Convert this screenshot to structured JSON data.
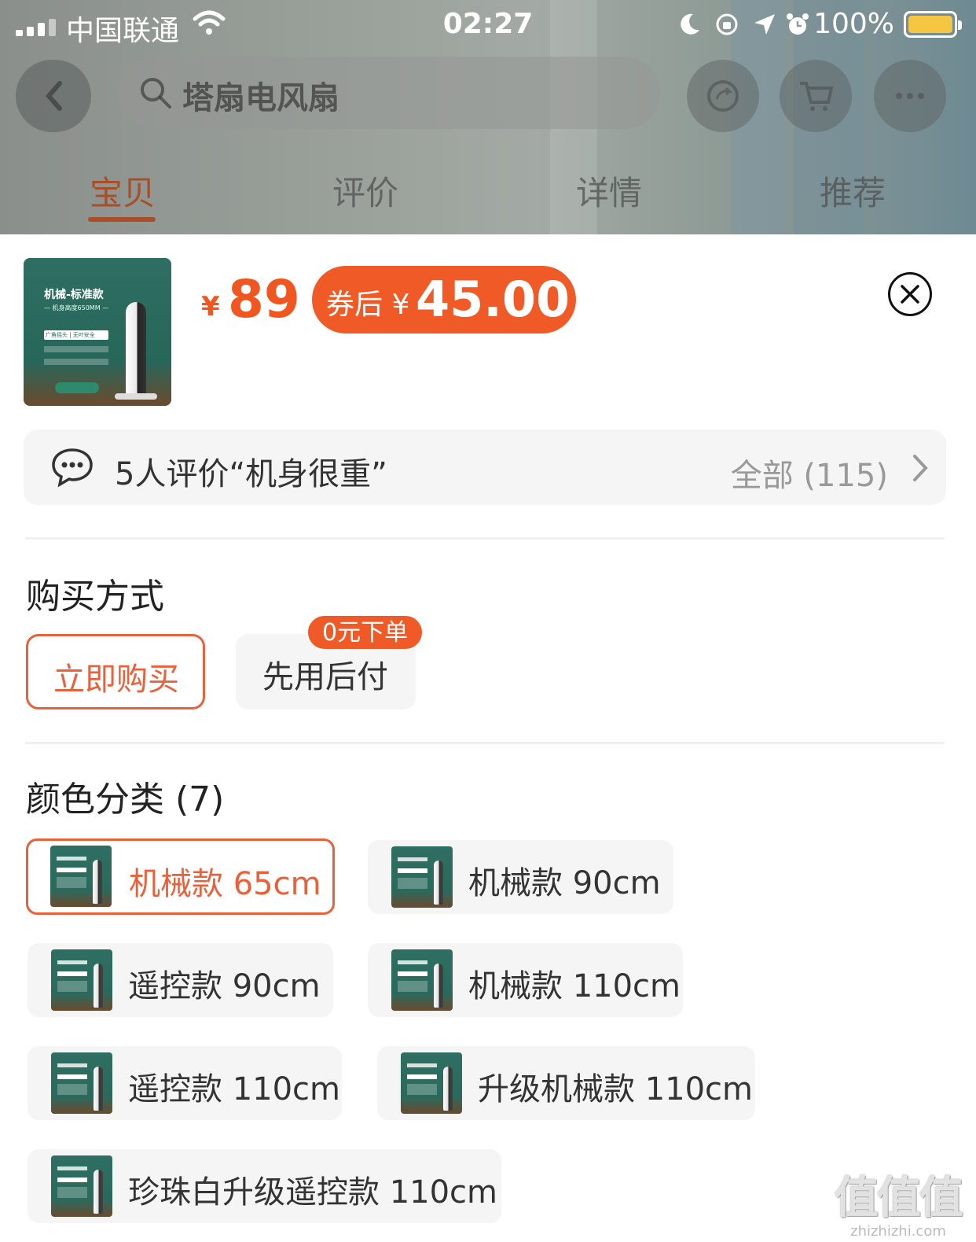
{
  "status_bar": {
    "carrier": "中国联通",
    "time": "02:27",
    "battery": "100%",
    "battery_color": "#f5c642"
  },
  "background_header": {
    "search_text": "塔扇电风扇",
    "tabs": [
      {
        "label": "宝贝",
        "active": true
      },
      {
        "label": "评价",
        "active": false
      },
      {
        "label": "详情",
        "active": false
      },
      {
        "label": "推荐",
        "active": false
      }
    ],
    "icons": [
      "back-icon",
      "search-icon",
      "share-icon",
      "cart-icon",
      "more-icon"
    ]
  },
  "sheet": {
    "product_image": {
      "title": "机械-标准款",
      "subtitle": "— 机身高度650MM —",
      "feature": "广角摇头 | 无叶安全"
    },
    "currency": "¥",
    "price": "89",
    "coupon_label": "券后 ¥",
    "coupon_price": "45.00",
    "accent_color": "#ef5a26",
    "review": {
      "text": "5人评价“机身很重”",
      "all": "全部 (115)"
    },
    "purchase": {
      "title": "购买方式",
      "options": [
        {
          "label": "立即购买",
          "selected": true
        },
        {
          "label": "先用后付",
          "selected": false
        }
      ],
      "badge": "0元下单"
    },
    "color": {
      "title": "颜色分类 (7)",
      "items": [
        {
          "label": "机械款 65cm",
          "selected": true
        },
        {
          "label": "机械款 90cm",
          "selected": false
        },
        {
          "label": "遥控款 90cm",
          "selected": false
        },
        {
          "label": "机械款 110cm",
          "selected": false
        },
        {
          "label": "遥控款 110cm",
          "selected": false
        },
        {
          "label": "升级机械款 110cm",
          "selected": false
        },
        {
          "label": "珍珠白升级遥控款 110cm",
          "selected": false
        }
      ]
    }
  },
  "watermark": {
    "text": "值值值",
    "url": "zhizhizhi.com"
  }
}
